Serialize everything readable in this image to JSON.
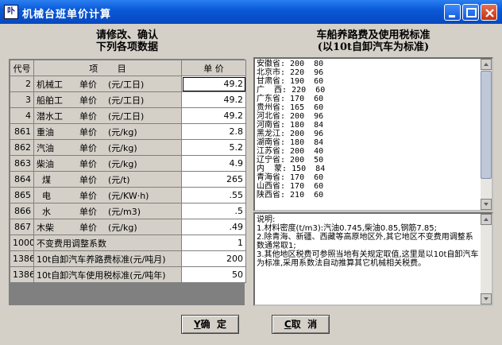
{
  "window": {
    "title": "机械台班单价计算",
    "icon_glyph": "卟"
  },
  "left_heading": {
    "line1": "请修改、确认",
    "line2": "下列各项数据"
  },
  "right_heading": {
    "line1": "车船养路费及使用税标准",
    "line2": "(以10t自卸汽车为标准)"
  },
  "table": {
    "headers": {
      "code": "代号",
      "item": "项       目",
      "price": "单  价"
    },
    "rows": [
      {
        "code": "2",
        "name": "机械工",
        "label": "单价",
        "unit": "(元/工日)",
        "price": "49.2"
      },
      {
        "code": "3",
        "name": "船舶工",
        "label": "单价",
        "unit": "(元/工日)",
        "price": "49.2"
      },
      {
        "code": "4",
        "name": "潜水工",
        "label": "单价",
        "unit": "(元/工日)",
        "price": "49.2"
      },
      {
        "code": "861",
        "name": "重油",
        "label": "单价",
        "unit": "(元/kg)",
        "price": "2.8"
      },
      {
        "code": "862",
        "name": "汽油",
        "label": "单价",
        "unit": "(元/kg)",
        "price": "5.2"
      },
      {
        "code": "863",
        "name": "柴油",
        "label": "单价",
        "unit": "(元/kg)",
        "price": "4.9"
      },
      {
        "code": "864",
        "name": "  煤",
        "label": "单价",
        "unit": "(元/t)",
        "price": "265"
      },
      {
        "code": "865",
        "name": "  电",
        "label": "单价",
        "unit": "(元/KW·h)",
        "price": ".55"
      },
      {
        "code": "866",
        "name": "  水",
        "label": "单价",
        "unit": "(元/m3)",
        "price": ".5"
      },
      {
        "code": "867",
        "name": "木柴",
        "label": "单价",
        "unit": "(元/kg)",
        "price": ".49"
      },
      {
        "code": "1000",
        "name": "不变费用调整系数",
        "label": "",
        "unit": "",
        "price": "1"
      },
      {
        "code": "1386",
        "name": "10t自卸汽车养路费标准(元/吨月)",
        "label": "",
        "unit": "",
        "price": "200"
      },
      {
        "code": "1386",
        "name": "10t自卸汽车使用税标准(元/吨年)",
        "label": "",
        "unit": "",
        "price": "50"
      }
    ]
  },
  "province_list": [
    "安徽省: 200  80",
    "北京市: 220  96",
    "甘肃省: 190  60",
    "广  西: 220  60",
    "广东省: 170  60",
    "贵州省: 165  60",
    "河北省: 200  96",
    "河南省: 180  84",
    "黑龙江: 200  96",
    "湖南省: 180  84",
    "江苏省: 200  40",
    "辽宁省: 200  50",
    "内  蒙: 150  84",
    "青海省: 170  60",
    "山西省: 170  60",
    "陕西省: 210  60"
  ],
  "notes": [
    "说明:",
    "1.材料密度(t/m3):汽油0.745,柴油0.85,钢筋7.85;",
    "2.除青海、新疆、西藏等高原地区外,其它地区不变费用调整系数通常取1;",
    "3.其他地区税费可参照当地有关规定取值,这里是以10t自卸汽车为标准,采用系数法自动推算其它机械相关税费。"
  ],
  "buttons": {
    "ok": {
      "hotkey": "Y",
      "label": "确  定"
    },
    "cancel": {
      "hotkey": "C",
      "label": "取  消"
    }
  }
}
